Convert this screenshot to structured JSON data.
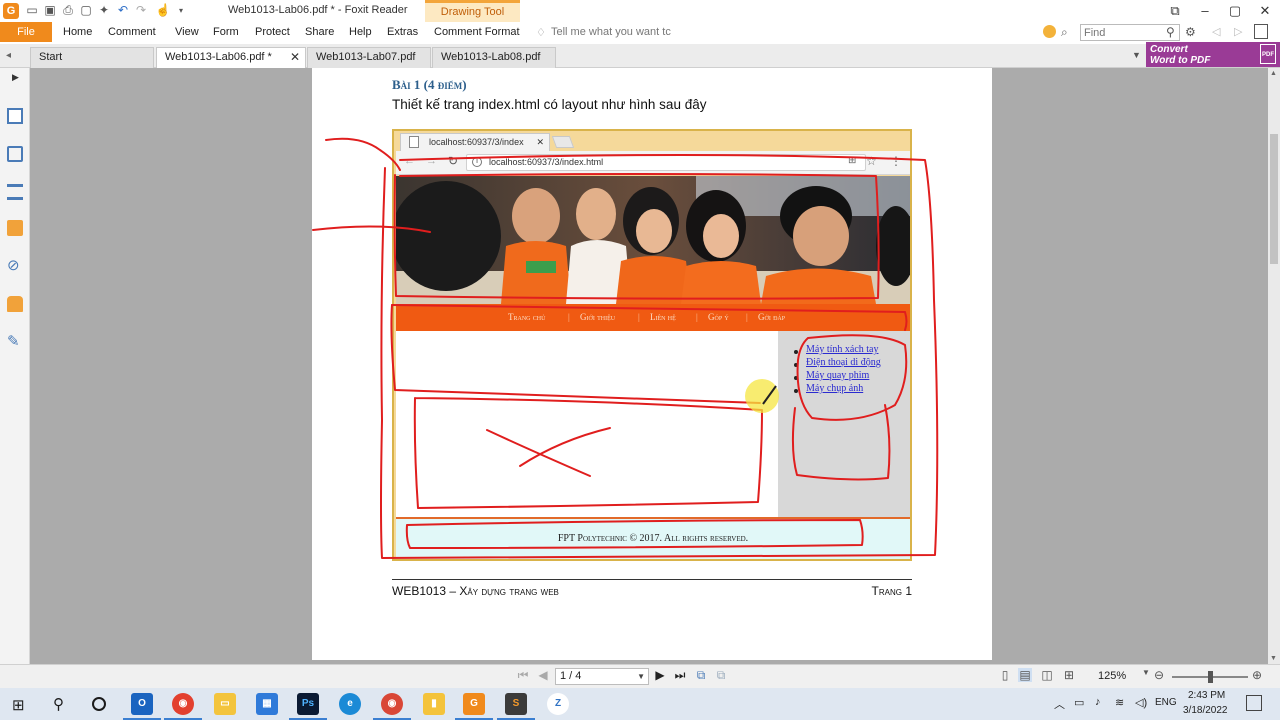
{
  "window": {
    "title": "Web1013-Lab06.pdf * - Foxit Reader",
    "contextual_tab": "Drawing Tool"
  },
  "menu": {
    "file": "File",
    "items": [
      "Home",
      "Comment",
      "View",
      "Form",
      "Protect",
      "Share",
      "Help",
      "Extras",
      "Comment Format"
    ],
    "tell_me": "Tell me what you want tc",
    "find_placeholder": "Find"
  },
  "tabs": [
    {
      "label": "Start"
    },
    {
      "label": "Web1013-Lab06.pdf *"
    },
    {
      "label": "Web1013-Lab07.pdf"
    },
    {
      "label": "Web1013-Lab08.pdf"
    }
  ],
  "convert_banner": {
    "line1": "Convert",
    "line2": "Word to PDF",
    "badge": "PDF"
  },
  "document": {
    "heading": "Bài 1 (4 điểm)",
    "description": "Thiết kế trang index.html có layout như hình sau đây",
    "figure": {
      "browser_tab": "localhost:60937/3/index",
      "url": "localhost:60937/3/index.html",
      "nav_items": [
        "Trang chủ",
        "Giới thiệu",
        "Liên hệ",
        "Góp ý",
        "Gởi đáp"
      ],
      "sidebar_links": [
        "Máy tính xách tay",
        "Điện thoại di động",
        "Máy quay phim",
        "Máy chụp ảnh"
      ],
      "footer": "FPT Polytechnic © 2017. All rights reserved."
    },
    "page_footer_left": "WEB1013 – Xây dựng trang web",
    "page_footer_right": "Trang 1"
  },
  "statusbar": {
    "page_indicator": "1 / 4",
    "zoom": "125%"
  },
  "taskbar": {
    "lang": "ENG",
    "time": "2:43 PM",
    "date": "3/18/2022"
  },
  "colors": {
    "foxit_orange": "#f08a1c",
    "annotation_red": "#e01e1e",
    "figure_nav": "#f05a12",
    "convert_purple": "#9a3b96"
  }
}
